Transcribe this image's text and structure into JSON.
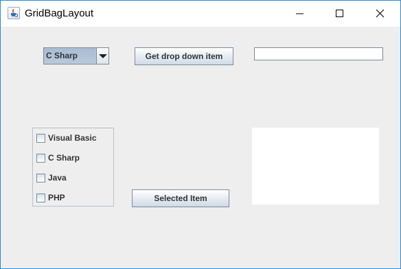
{
  "window": {
    "title": "GridBagLayout"
  },
  "icons": {
    "app": "java-cup-icon",
    "minimize": "minimize-icon",
    "maximize": "maximize-icon",
    "close": "close-icon",
    "dropdown": "chevron-down-icon"
  },
  "combo": {
    "selected": "C Sharp"
  },
  "buttons": {
    "get_drop_down": "Get drop down item",
    "selected_item": "Selected Item"
  },
  "textfield": {
    "value": ""
  },
  "checkboxes": [
    {
      "label": "Visual Basic",
      "checked": false
    },
    {
      "label": "C Sharp",
      "checked": false
    },
    {
      "label": "Java",
      "checked": false
    },
    {
      "label": "PHP",
      "checked": false
    }
  ],
  "colors": {
    "window_border": "#2a8ad6",
    "client_background": "#eeeeee",
    "combo_selection": "#b8c8dc"
  }
}
